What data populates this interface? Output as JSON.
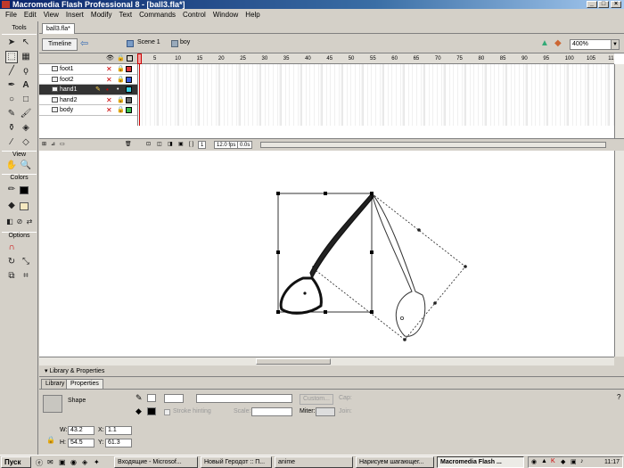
{
  "window": {
    "title": "Macromedia Flash Professional 8 - [ball3.fla*]",
    "controls": [
      "_",
      "□",
      "×"
    ]
  },
  "menu": [
    "File",
    "Edit",
    "View",
    "Insert",
    "Modify",
    "Text",
    "Commands",
    "Control",
    "Window",
    "Help"
  ],
  "tools": {
    "title": "Tools",
    "view_label": "View",
    "colors_label": "Colors",
    "options_label": "Options"
  },
  "document": {
    "tab": "ball3.fla*",
    "timeline_button": "Timeline",
    "scene": "Scene 1",
    "symbol": "boy",
    "zoom": "400%"
  },
  "timeline": {
    "ruler": [
      "5",
      "10",
      "15",
      "20",
      "25",
      "30",
      "35",
      "40",
      "45",
      "50",
      "55",
      "60",
      "65",
      "70",
      "75",
      "80",
      "85",
      "90",
      "95",
      "100",
      "105",
      "11"
    ],
    "layers": [
      {
        "name": "foot1",
        "color": "#e0383a",
        "selected": false
      },
      {
        "name": "foot2",
        "color": "#3a5de0",
        "selected": false
      },
      {
        "name": "hand1",
        "color": "#3acfe0",
        "selected": true
      },
      {
        "name": "hand2",
        "color": "#6b6b6b",
        "selected": false
      },
      {
        "name": "body",
        "color": "#38c04a",
        "selected": false
      }
    ],
    "current_frame": "1",
    "fps": "12.0 fps",
    "time": "0.0s"
  },
  "properties": {
    "panel_title": "Library & Properties",
    "tabs": [
      "Library",
      "Properties"
    ],
    "shape_label": "Shape",
    "custom_button": "Custom...",
    "cap_label": "Cap:",
    "stroke_hinting": "Stroke hinting",
    "scale_label": "Scale:",
    "miter_label": "Miter:",
    "join_label": "Join:",
    "w_label": "W:",
    "w_value": "43.2",
    "h_label": "H:",
    "h_value": "54.5",
    "x_label": "X:",
    "x_value": "1.1",
    "y_label": "Y:",
    "y_value": "61.3"
  },
  "taskbar": {
    "start": "Пуск",
    "tasks": [
      {
        "label": "Входящие - Microsof..."
      },
      {
        "label": "Новый Геродот :: П..."
      },
      {
        "label": "anime"
      },
      {
        "label": "Нарисуем шагающег..."
      },
      {
        "label": "Macromedia Flash ..."
      }
    ],
    "clock": "11:17"
  }
}
